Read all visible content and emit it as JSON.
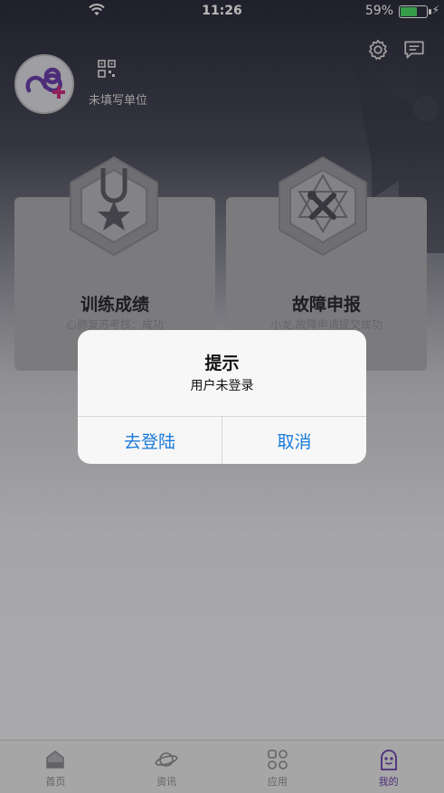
{
  "status_bar": {
    "time": "11:26",
    "battery": "59%",
    "battery_level": 0.59
  },
  "header": {
    "organization": "未填写单位"
  },
  "cards": [
    {
      "title": "训练成绩",
      "subtitle": "心肺复苏考核：成功"
    },
    {
      "title": "故障申报",
      "subtitle": "小龙,故障申请提交成功"
    }
  ],
  "tabs": [
    {
      "label": "首页",
      "icon": "home-icon",
      "active": false
    },
    {
      "label": "资讯",
      "icon": "planet-icon",
      "active": false
    },
    {
      "label": "应用",
      "icon": "apps-icon",
      "active": false
    },
    {
      "label": "我的",
      "icon": "profile-icon",
      "active": true
    }
  ],
  "alert": {
    "title": "提示",
    "message": "用户未登录",
    "confirm_label": "去登陆",
    "cancel_label": "取消"
  },
  "colors": {
    "accent": "#1a7ad8",
    "brand_purple": "#6a3fa8",
    "battery_green": "#4cd964"
  }
}
